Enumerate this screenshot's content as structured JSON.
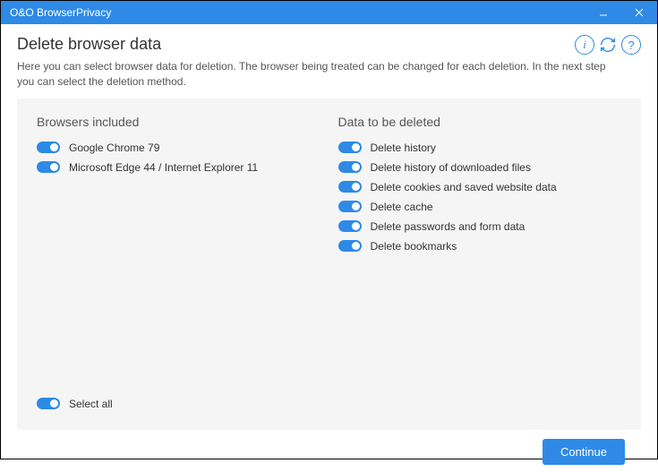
{
  "window": {
    "title": "O&O BrowserPrivacy"
  },
  "header": {
    "title": "Delete browser data",
    "description": "Here you can select browser data for deletion. The browser being treated can be changed for each deletion. In the next step you can select the deletion method."
  },
  "panel": {
    "browsers_heading": "Browsers included",
    "data_heading": "Data to be deleted",
    "browsers": [
      {
        "label": "Google Chrome 79"
      },
      {
        "label": "Microsoft Edge 44 / Internet Explorer 11"
      }
    ],
    "data_items": [
      {
        "label": "Delete history"
      },
      {
        "label": "Delete history of downloaded files"
      },
      {
        "label": "Delete cookies and saved website data"
      },
      {
        "label": "Delete cache"
      },
      {
        "label": "Delete passwords and form data"
      },
      {
        "label": "Delete bookmarks"
      }
    ],
    "select_all_label": "Select all"
  },
  "footer": {
    "continue_label": "Continue"
  }
}
